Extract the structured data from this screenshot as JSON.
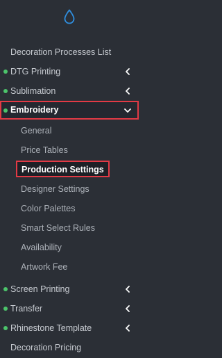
{
  "logo_icon": "drop-icon",
  "accent_color": "#2f8fe0",
  "status_dot_color": "#4cc46b",
  "highlight_color": "#e23a45",
  "menu": {
    "decoration_processes_list": "Decoration Processes List",
    "dtg_printing": "DTG Printing",
    "sublimation": "Sublimation",
    "embroidery": "Embroidery",
    "embroidery_sub": [
      "General",
      "Price Tables",
      "Production Settings",
      "Designer Settings",
      "Color Palettes",
      "Smart Select Rules",
      "Availability",
      "Artwork Fee"
    ],
    "screen_printing": "Screen Printing",
    "transfer": "Transfer",
    "rhinestone_template": "Rhinestone Template",
    "decoration_pricing": "Decoration Pricing"
  }
}
